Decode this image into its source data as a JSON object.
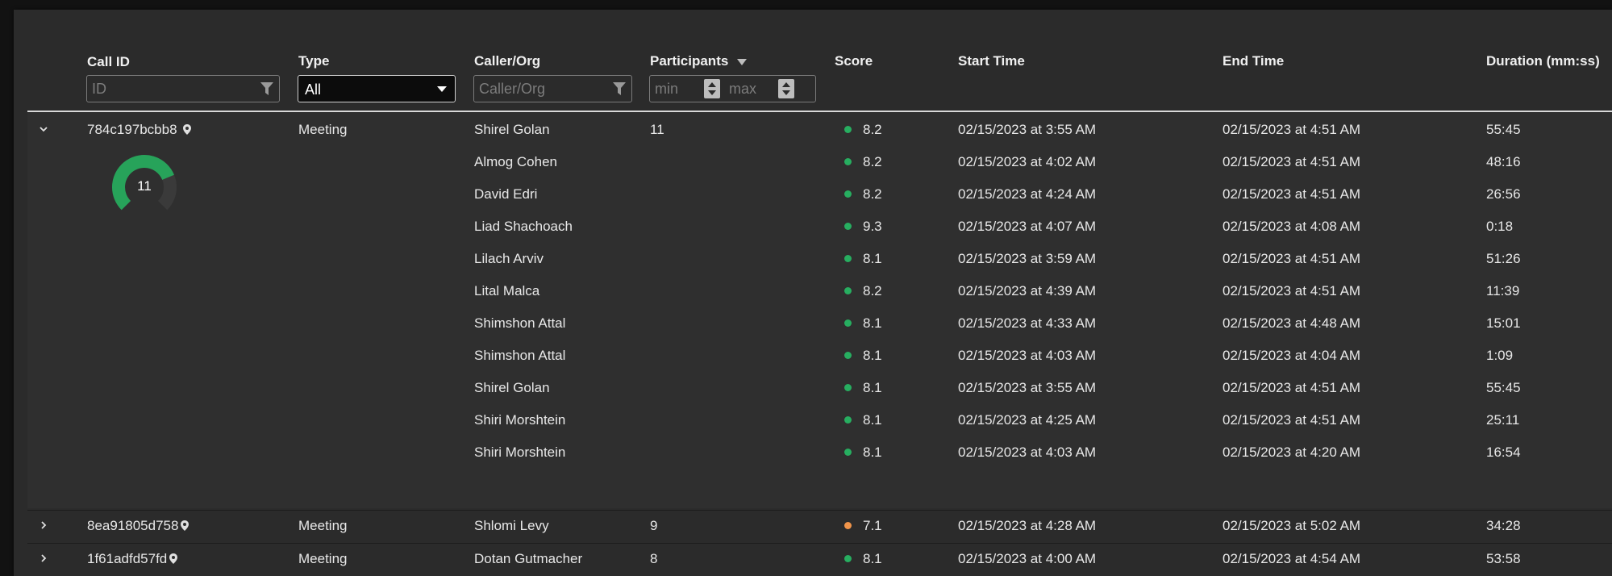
{
  "columns": {
    "call_id": "Call ID",
    "type": "Type",
    "caller": "Caller/Org",
    "participants": "Participants",
    "score": "Score",
    "start": "Start Time",
    "end": "End Time",
    "duration": "Duration (mm:ss)"
  },
  "filters": {
    "id_placeholder": "ID",
    "type_value": "All",
    "caller_placeholder": "Caller/Org",
    "min_placeholder": "min",
    "max_placeholder": "max"
  },
  "expanded_row": {
    "call_id": "784c197bcbb8",
    "type": "Meeting",
    "caller": "Shirel Golan",
    "participants": "11",
    "score": "8.2",
    "score_color": "#27ae60",
    "start": "02/15/2023 at 3:55 AM",
    "end": "02/15/2023 at 4:51 AM",
    "duration": "55:45",
    "gauge": {
      "label": "11",
      "fill_fraction": 0.75,
      "color": "#27a35a",
      "track_color": "#3a3a3a"
    },
    "participant_rows": [
      {
        "name": "Almog Cohen",
        "score": "8.2",
        "start": "02/15/2023 at 4:02 AM",
        "end": "02/15/2023 at 4:51 AM",
        "duration": "48:16"
      },
      {
        "name": "David Edri",
        "score": "8.2",
        "start": "02/15/2023 at 4:24 AM",
        "end": "02/15/2023 at 4:51 AM",
        "duration": "26:56"
      },
      {
        "name": "Liad Shachoach",
        "score": "9.3",
        "start": "02/15/2023 at 4:07 AM",
        "end": "02/15/2023 at 4:08 AM",
        "duration": "0:18"
      },
      {
        "name": "Lilach Arviv",
        "score": "8.1",
        "start": "02/15/2023 at 3:59 AM",
        "end": "02/15/2023 at 4:51 AM",
        "duration": "51:26"
      },
      {
        "name": "Lital Malca",
        "score": "8.2",
        "start": "02/15/2023 at 4:39 AM",
        "end": "02/15/2023 at 4:51 AM",
        "duration": "11:39"
      },
      {
        "name": "Shimshon Attal",
        "score": "8.1",
        "start": "02/15/2023 at 4:33 AM",
        "end": "02/15/2023 at 4:48 AM",
        "duration": "15:01"
      },
      {
        "name": "Shimshon Attal",
        "score": "8.1",
        "start": "02/15/2023 at 4:03 AM",
        "end": "02/15/2023 at 4:04 AM",
        "duration": "1:09"
      },
      {
        "name": "Shirel Golan",
        "score": "8.1",
        "start": "02/15/2023 at 3:55 AM",
        "end": "02/15/2023 at 4:51 AM",
        "duration": "55:45"
      },
      {
        "name": "Shiri Morshtein",
        "score": "8.1",
        "start": "02/15/2023 at 4:25 AM",
        "end": "02/15/2023 at 4:51 AM",
        "duration": "25:11"
      },
      {
        "name": "Shiri Morshtein",
        "score": "8.1",
        "start": "02/15/2023 at 4:03 AM",
        "end": "02/15/2023 at 4:20 AM",
        "duration": "16:54"
      }
    ]
  },
  "collapsed_rows": [
    {
      "call_id": "8ea91805d758",
      "type": "Meeting",
      "caller": "Shlomi Levy",
      "participants": "9",
      "score": "7.1",
      "score_color": "#f0944a",
      "start": "02/15/2023 at 4:28 AM",
      "end": "02/15/2023 at 5:02 AM",
      "duration": "34:28"
    },
    {
      "call_id": "1f61adfd57fd",
      "type": "Meeting",
      "caller": "Dotan Gutmacher",
      "participants": "8",
      "score": "8.1",
      "score_color": "#27ae60",
      "start": "02/15/2023 at 4:00 AM",
      "end": "02/15/2023 at 4:54 AM",
      "duration": "53:58"
    }
  ],
  "colors": {
    "score_good": "#27ae60",
    "score_warn": "#f0944a"
  }
}
